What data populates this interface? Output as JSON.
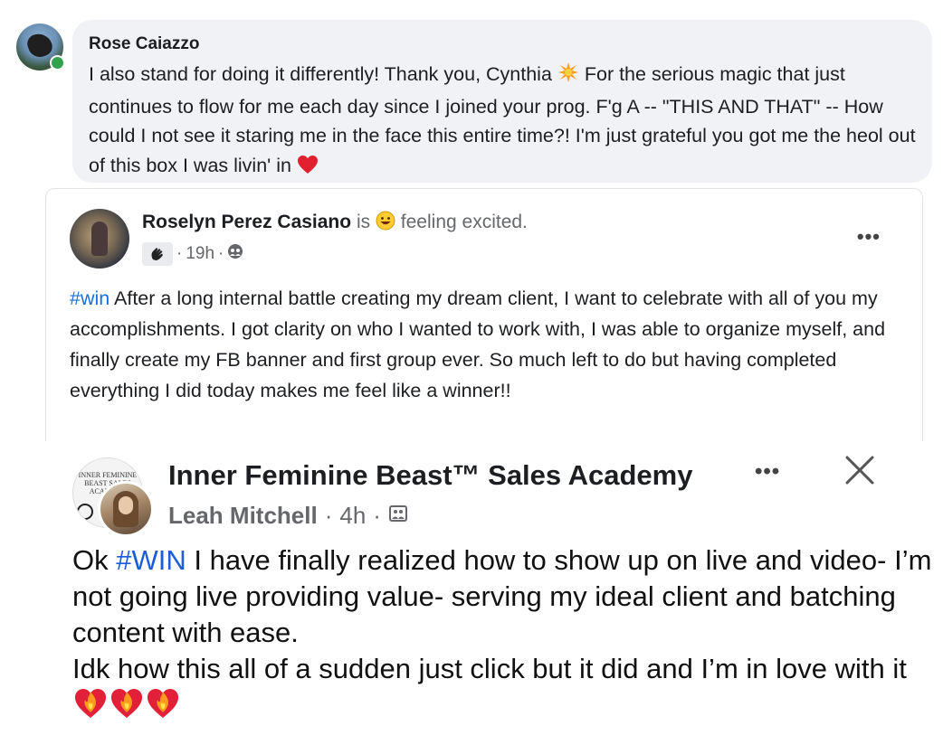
{
  "comment": {
    "author": "Rose Caiazzo",
    "text_a": "I also stand for doing it differently! Thank you, Cynthia ",
    "text_b": " For the serious magic that just continues to flow for me each day since I joined your prog. F'g A -- \"THIS AND THAT\" -- How could I not see it staring me in the face this entire time?! I'm just grateful you got me the heol out of this box I was livin' in ",
    "emoji_burst": "sparkle-burst-icon",
    "emoji_heart": "red-heart-icon"
  },
  "post": {
    "author": "Roselyn Perez Casiano",
    "is_text": "is",
    "feeling_text": "feeling excited.",
    "time": "19h",
    "separator": "·",
    "hashtag": "#win",
    "body": " After a long internal battle creating my dream client, I want to celebrate with all of you my accomplishments. I got clarity on who I wanted to work with, I was able to organize myself, and finally create my FB banner and first group ever. So much left to do but having completed everything I did today makes me feel like a winner!!"
  },
  "card": {
    "group_name": "Inner Feminine Beast™ Sales Academy",
    "logo_text": "INNER FEMININE BEAST SALES ACADEMY",
    "author": "Leah Mitchell",
    "time": "4h",
    "separator": "·",
    "prefix": "Ok ",
    "hashtag": "#WIN",
    "body_1": " I have finally realized how to show up on live and video- I’m not going live providing value- serving my ideal client and batching content with ease.",
    "body_2": "Idk how this all of a sudden just click but it did and I’m in love with it",
    "heart_icons": [
      "heart-on-fire-icon",
      "heart-on-fire-icon",
      "heart-on-fire-icon"
    ]
  },
  "colors": {
    "hashtag": "#1a6ed8",
    "online": "#31a24c",
    "bubble": "#f0f2f5",
    "muted": "#65676b"
  }
}
